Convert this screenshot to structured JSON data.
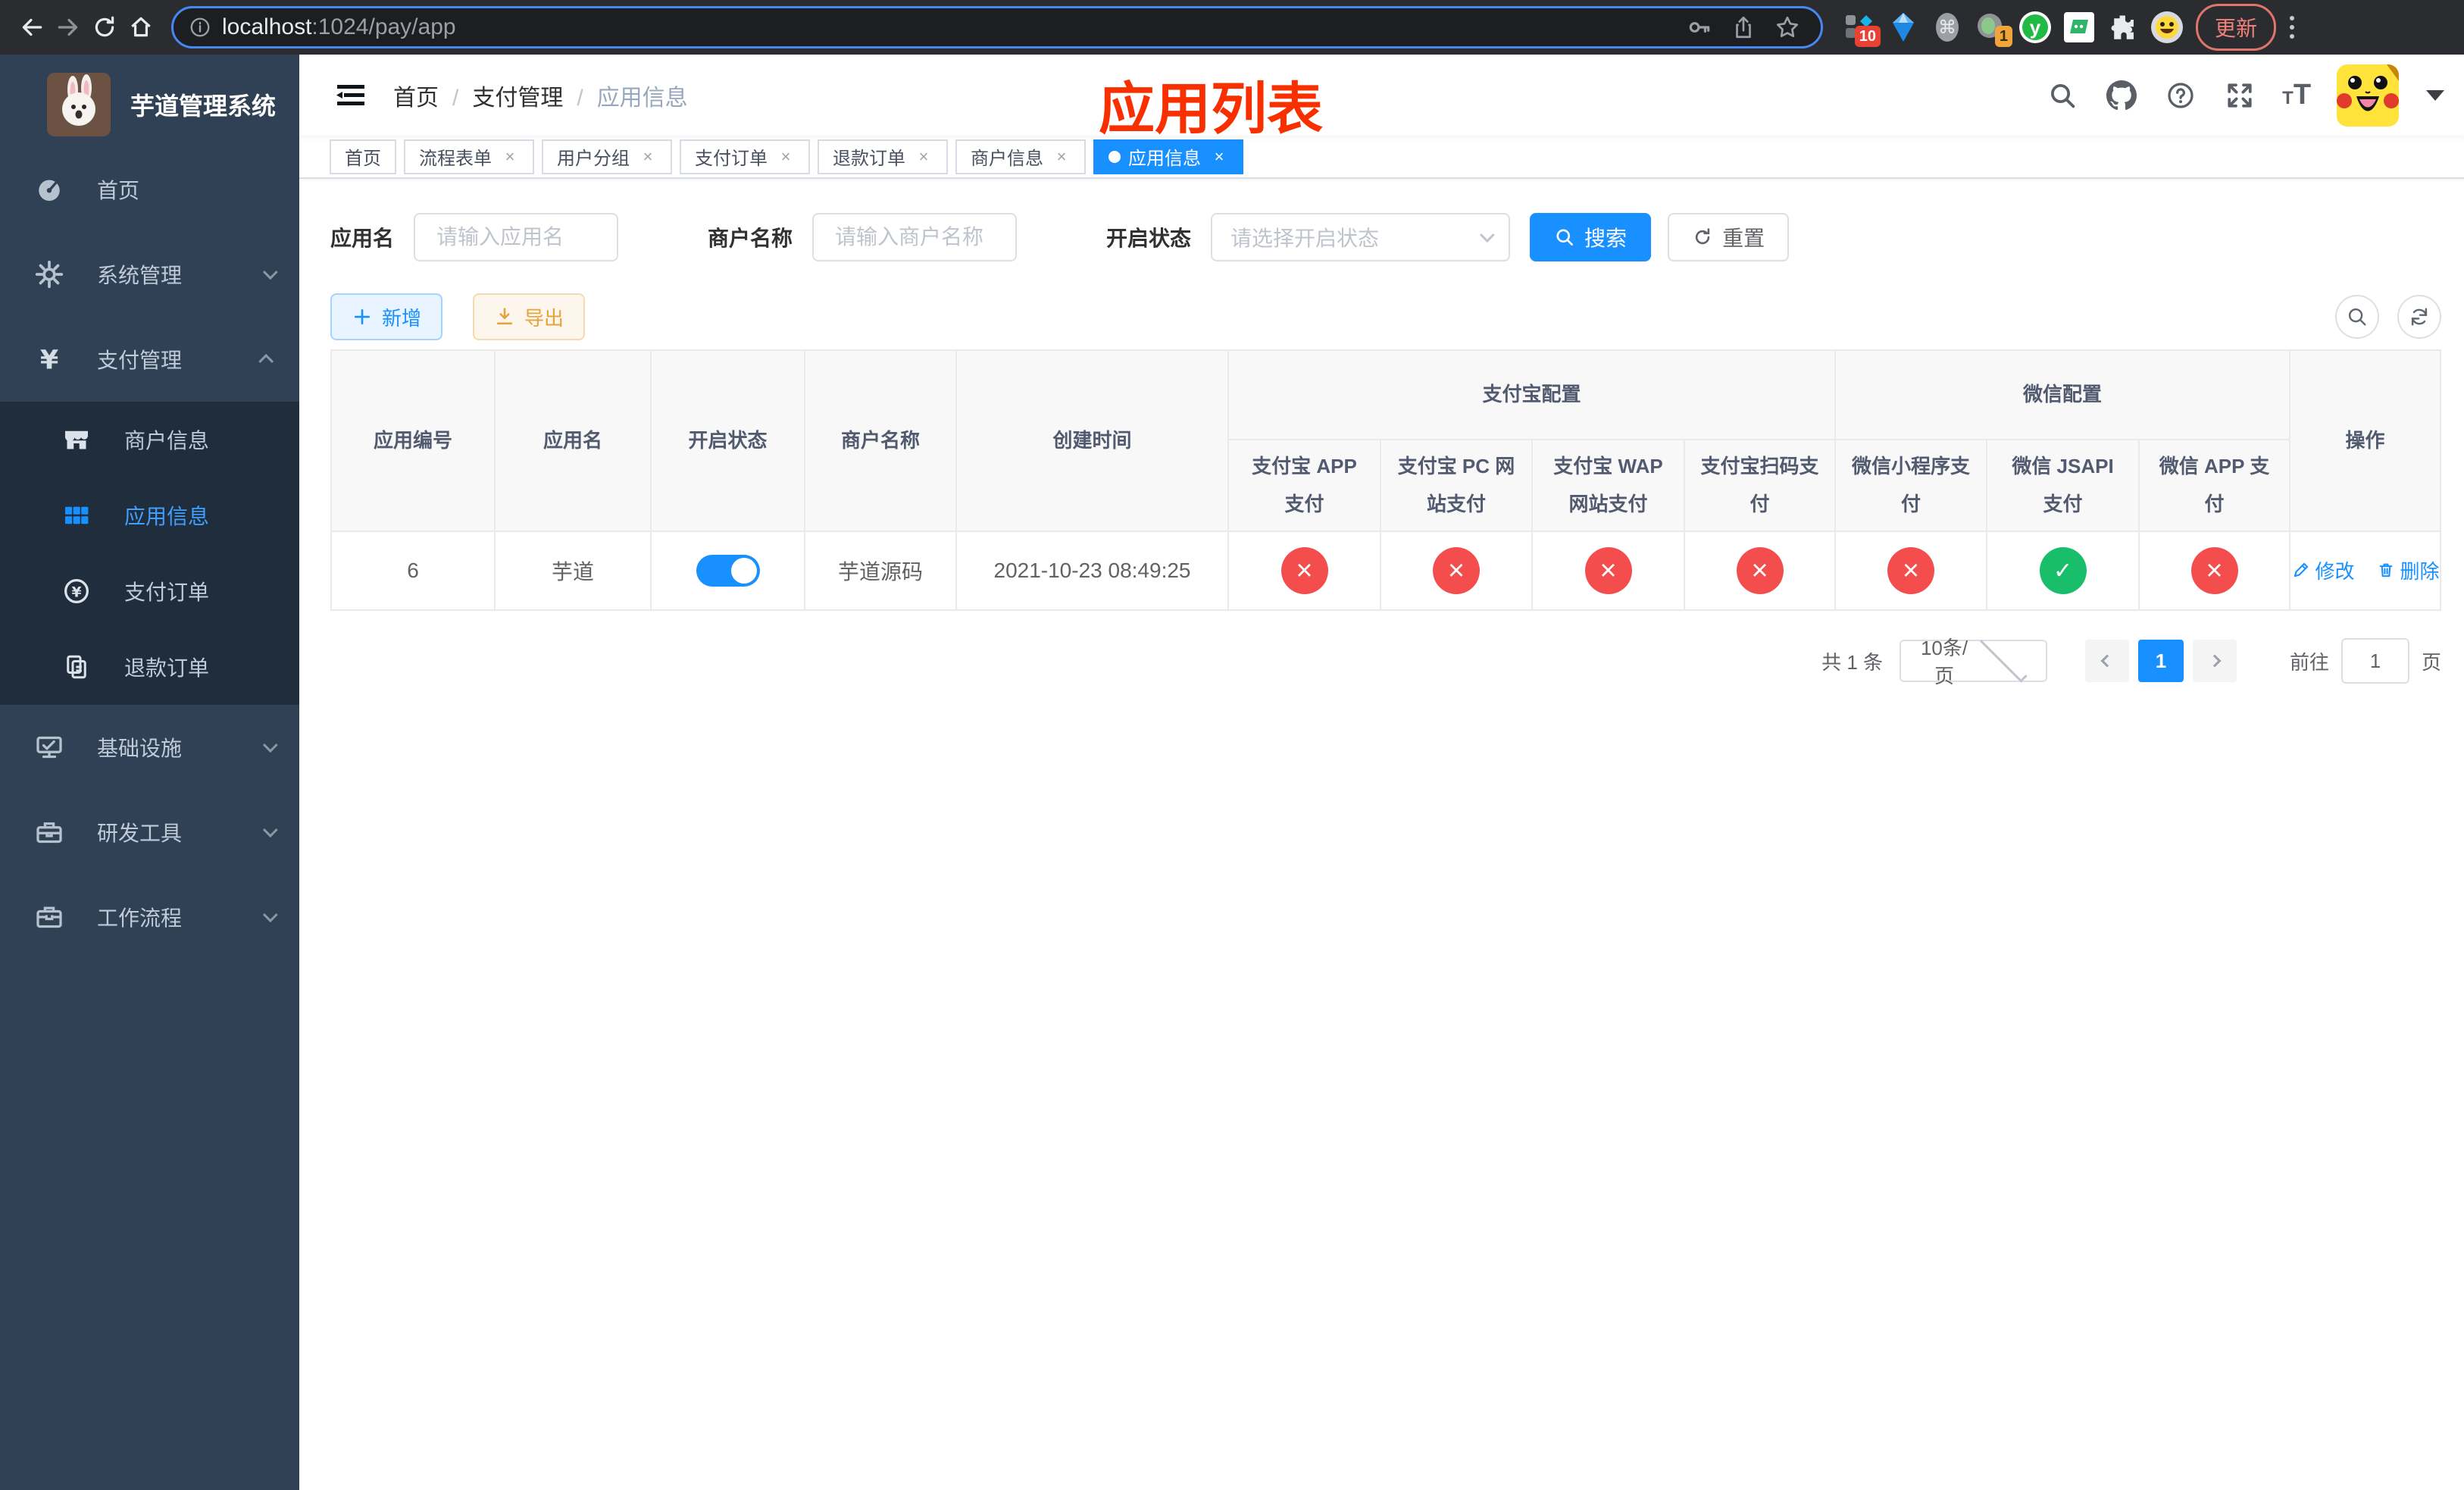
{
  "theme": {
    "accent": "#1890ff",
    "danger": "#f34d4d",
    "success": "#19be6b",
    "sidebar_bg": "#304156",
    "submenu_bg": "#1f2d3d",
    "annotation_red": "#f83000"
  },
  "browser": {
    "url_host": "localhost",
    "url_path": ":1024/pay/app",
    "update_label": "更新",
    "ext_badge_ten": "10",
    "ext_badge_one": "1",
    "ext_y_letter": "y"
  },
  "sidebar": {
    "title": "芋道管理系统",
    "items": [
      {
        "label": "首页"
      },
      {
        "label": "系统管理"
      },
      {
        "label": "支付管理"
      },
      {
        "label": "商户信息"
      },
      {
        "label": "应用信息"
      },
      {
        "label": "支付订单"
      },
      {
        "label": "退款订单"
      },
      {
        "label": "基础设施"
      },
      {
        "label": "研发工具"
      },
      {
        "label": "工作流程"
      }
    ]
  },
  "navbar": {
    "breadcrumb": [
      "首页",
      "支付管理",
      "应用信息"
    ]
  },
  "annotation": {
    "text": "应用列表"
  },
  "tabs": [
    {
      "label": "首页"
    },
    {
      "label": "流程表单"
    },
    {
      "label": "用户分组"
    },
    {
      "label": "支付订单"
    },
    {
      "label": "退款订单"
    },
    {
      "label": "商户信息"
    },
    {
      "label": "应用信息"
    }
  ],
  "filters": {
    "app_name_label": "应用名",
    "app_name_placeholder": "请输入应用名",
    "merchant_label": "商户名称",
    "merchant_placeholder": "请输入商户名称",
    "status_label": "开启状态",
    "status_placeholder": "请选择开启状态",
    "search_label": "搜索",
    "reset_label": "重置"
  },
  "toolbar": {
    "add_label": "新增",
    "export_label": "导出"
  },
  "table": {
    "simple_columns": [
      "应用编号",
      "应用名",
      "开启状态",
      "商户名称",
      "创建时间"
    ],
    "group_alipay": {
      "label": "支付宝配置",
      "children": [
        "支付宝 APP 支付",
        "支付宝 PC 网站支付",
        "支付宝 WAP 网站支付",
        "支付宝扫码支付"
      ]
    },
    "group_wechat": {
      "label": "微信配置",
      "children": [
        "微信小程序支付",
        "微信 JSAPI 支付",
        "微信 APP 支付"
      ]
    },
    "actions_label": "操作",
    "rows": [
      {
        "id": "6",
        "name": "芋道",
        "enabled": true,
        "merchant": "芋道源码",
        "created": "2021-10-23 08:49:25",
        "statuses": [
          "cross",
          "cross",
          "cross",
          "cross",
          "cross",
          "check",
          "cross"
        ],
        "edit_label": "修改",
        "delete_label": "删除"
      }
    ]
  },
  "pagination": {
    "total": "共 1 条",
    "page_size": "10条/页",
    "page": "1",
    "goto_label": "前往",
    "goto_value": "1",
    "unit_label": "页"
  }
}
